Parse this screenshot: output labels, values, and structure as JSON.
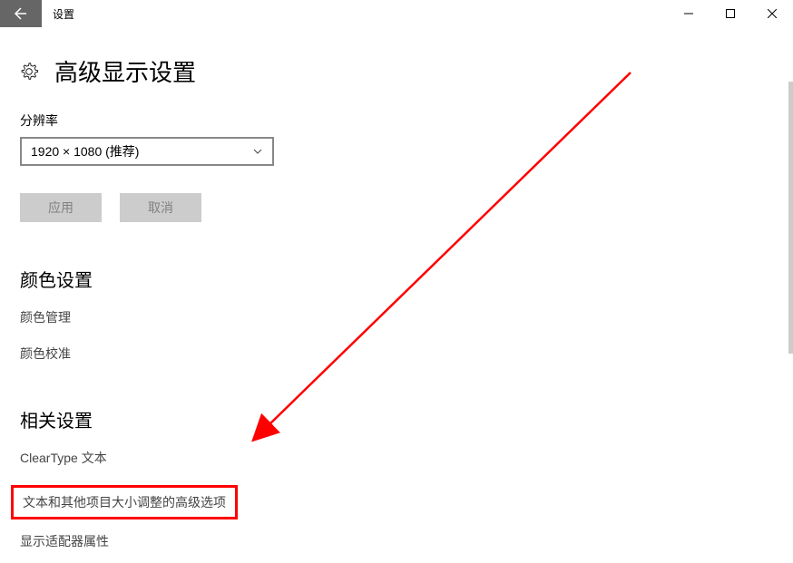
{
  "window": {
    "title": "设置"
  },
  "header": {
    "title": "高级显示设置"
  },
  "resolution": {
    "label": "分辨率",
    "value": "1920 × 1080 (推荐)"
  },
  "buttons": {
    "apply": "应用",
    "cancel": "取消"
  },
  "colorSection": {
    "title": "颜色设置",
    "links": {
      "manage": "颜色管理",
      "calibrate": "颜色校准"
    }
  },
  "relatedSection": {
    "title": "相关设置",
    "links": {
      "cleartype": "ClearType 文本",
      "textsize": "文本和其他项目大小调整的高级选项",
      "adapter": "显示适配器属性"
    }
  }
}
